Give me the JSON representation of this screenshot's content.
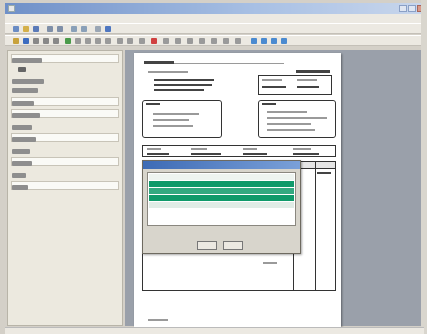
{
  "window": {
    "title": "",
    "accent": "#6f90c8"
  },
  "menubar": {
    "items": []
  },
  "sidebar": {
    "items": []
  },
  "document": {
    "header_label": "",
    "doc_type_label": "",
    "company": "",
    "bill_to_label": "",
    "ship_to_label": "",
    "bill_to_lines": [],
    "ship_to_lines": []
  },
  "dialog": {
    "title": "",
    "rows": [],
    "ok_label": "",
    "cancel_label": "",
    "selection_color": "#0f9a6a"
  },
  "status": {
    "text": ""
  },
  "icons": [
    "app-icon",
    "minimize-icon",
    "maximize-icon",
    "close-icon",
    "new-icon",
    "open-icon",
    "save-icon",
    "print-icon",
    "find-icon",
    "help-icon"
  ]
}
